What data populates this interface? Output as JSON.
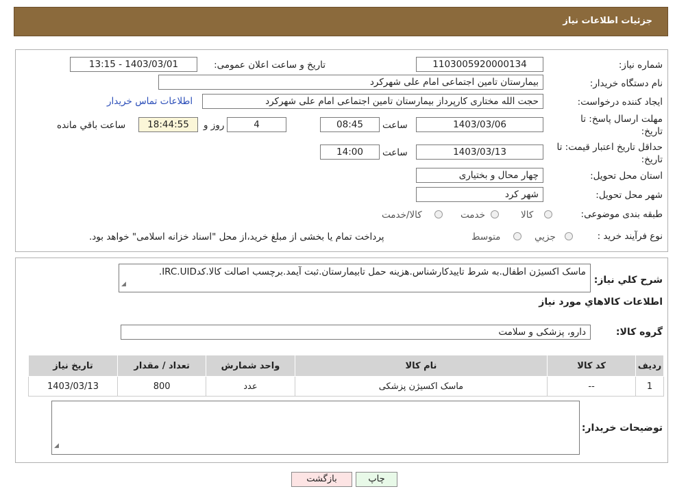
{
  "header": {
    "title": "جزئیات اطلاعات نیاز"
  },
  "form": {
    "need_number_label": "شماره نیاز:",
    "need_number": "1103005920000134",
    "announce_label": "تاریخ و ساعت اعلان عمومی:",
    "announce_value": "1403/03/01 - 13:15",
    "buyer_org_label": "نام دستگاه خریدار:",
    "buyer_org": "بیمارستان تامین اجتماعی امام علی شهرکرد",
    "creator_label": "ایجاد کننده درخواست:",
    "creator": "حجت الله مختاری کارپرداز بیمارستان تامین اجتماعی امام علی شهرکرد",
    "contact_link": "اطلاعات تماس خریدار",
    "deadline_label": "مهلت ارسال پاسخ: تا تاریخ:",
    "deadline_date": "1403/03/06",
    "time_label": "ساعت",
    "deadline_time": "08:45",
    "days": "4",
    "days_label": "روز و",
    "remaining": "18:44:55",
    "remaining_label": "ساعت باقي مانده",
    "min_validity_label": "حداقل تاریخ اعتبار قیمت: تا تاریخ:",
    "min_validity_date": "1403/03/13",
    "min_validity_time": "14:00",
    "province_label": "استان محل تحویل:",
    "province": "چهار محال و بختیاری",
    "city_label": "شهر محل تحویل:",
    "city": "شهر کرد",
    "category_label": "طبقه بندی موضوعی:",
    "category_options": [
      "کالا",
      "خدمت",
      "کالا/خدمت"
    ],
    "process_label": "نوع فرآیند خرید :",
    "process_options": [
      "جزیي",
      "متوسط"
    ],
    "process_note": "پرداخت تمام یا بخشی از مبلغ خرید،از محل \"اسناد خزانه اسلامی\" خواهد بود."
  },
  "details": {
    "summary_label": "شرح کلي نياز:",
    "summary": "ماسک اکسیژن اطفال.به شرط تاییدکارشناس.هزینه حمل تابیمارستان.ثبت آیمد.برچسب اصالت کالا.کدIRC.UID.",
    "items_title": "اطلاعات کالاهاي مورد نياز",
    "group_label": "گروه کالا:",
    "group": "دارو، پزشکی و سلامت",
    "table": {
      "headers": [
        "رديف",
        "کد کالا",
        "نام کالا",
        "واحد شمارش",
        "تعداد / مقدار",
        "تاریخ نیاز"
      ],
      "rows": [
        [
          "1",
          "--",
          "ماسک اکسیژن پزشکی",
          "عدد",
          "800",
          "1403/03/13"
        ]
      ]
    },
    "buyer_notes_label": "توضیحات خریدار:",
    "buyer_notes": ""
  },
  "buttons": {
    "print": "چاپ",
    "back": "بازگشت"
  },
  "colors": {
    "header_bg": "#8b6a3c",
    "link": "#2a4db8",
    "back_button_bg": "#fde4e4",
    "print_button_bg": "#e8f9e8"
  }
}
